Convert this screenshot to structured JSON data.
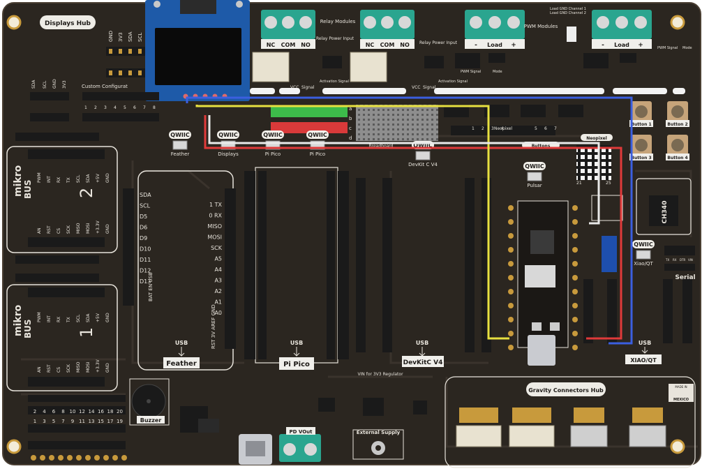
{
  "board": {
    "colors": {
      "pcb": "#2b2620",
      "trace": "#3a332c",
      "silk": "#e8e4dc",
      "header": "#1a1a1a",
      "gold": "#c89a3c",
      "terminal": "#2aa58f",
      "qwiic_bg": "#f2f0ea",
      "wire_blue": "#3b5fe0",
      "wire_red": "#e03a3a",
      "wire_yellow": "#e7e040",
      "wire_white": "#e9e9e9"
    }
  },
  "sections": {
    "displays_hub": "Displays Hub",
    "custom_config": "Custom Configurat",
    "relay_modules": "Relay Modules",
    "relay_power_input": "Relay Power Input",
    "pwm_modules": "PWM Modules",
    "gravity_hub": "Gravity Connectors Hub",
    "buzzer": "Buzzer",
    "external_supply": "External Supply",
    "pd_vout": "PD VOut",
    "vin_regulator": "VIN for 3V3 Regulator",
    "breadboard": "Breadboard",
    "buttons": "Buttons",
    "neopixel": "Neopixel",
    "serial": "Serial",
    "ch340": "CH340",
    "made_in": "MADE IN",
    "mexico": "MEXICO"
  },
  "terminals": {
    "relay1": [
      "NC",
      "COM",
      "NO"
    ],
    "relay2": [
      "NC",
      "COM",
      "NO"
    ],
    "load1": [
      "-",
      "Load",
      "+"
    ],
    "load2": [
      "-",
      "Load",
      "+"
    ]
  },
  "display_header": [
    "GND",
    "3V3",
    "SDA",
    "SCL"
  ],
  "custom_header": [
    "SDA",
    "SCL",
    "GND",
    "3V3"
  ],
  "custom_numbers": [
    "1",
    "2",
    "3",
    "4",
    "5",
    "6",
    "7",
    "8"
  ],
  "qwiic": {
    "brand": "QWIIC",
    "labels": [
      "Feather",
      "Displays",
      "Pi Pico",
      "Pi Pico",
      "DevKit C V4",
      "Pulsar",
      "Xiao/QT"
    ]
  },
  "mikrobus": {
    "brand_top": "mikro",
    "brand_bottom": "BUS",
    "slot1": "1",
    "slot2": "2",
    "top_pins": [
      "PWM",
      "INT",
      "RX",
      "TX",
      "SCL",
      "SDA",
      "+5V",
      "GND"
    ],
    "bottom_pins": [
      "AN",
      "RST",
      "CS",
      "SCK",
      "MISO",
      "MOSI",
      "+3.3V",
      "GND"
    ]
  },
  "feather_pins_left": [
    "SDA",
    "SCL",
    "D5",
    "D6",
    "D9",
    "D10",
    "D11",
    "D12",
    "D13"
  ],
  "feather_pins_right": [
    "1 TX",
    "0 RX",
    "MISO",
    "MOSI",
    "SCK",
    "A5",
    "A4",
    "A3",
    "A2",
    "A1",
    "A0"
  ],
  "feather_bottom_left": "BAT EN USB",
  "feather_bottom_right": "RST 3V AREF GND",
  "usb": "USB",
  "board_labels": [
    "Feather",
    "Pi Pico",
    "DevKitC V4",
    "XIAO/QT"
  ],
  "buttons": [
    "Button 1",
    "Button 2",
    "Button 3",
    "Button 4"
  ],
  "buzzer_numbers_top": [
    "2",
    "4",
    "6",
    "8",
    "10",
    "12",
    "14",
    "16",
    "18",
    "20"
  ],
  "buzzer_numbers_bottom": [
    "1",
    "3",
    "5",
    "7",
    "9",
    "11",
    "13",
    "15",
    "17",
    "19"
  ],
  "breadboard_rows": [
    "a",
    "b",
    "c",
    "d"
  ],
  "breadboard_numbers": [
    "1",
    "2",
    "3",
    "4",
    "5",
    "6",
    "7"
  ],
  "neopixel_index": [
    "21",
    "25"
  ],
  "relay_small": [
    "VCC",
    "Signal"
  ],
  "relay_activation": "Activation Signal",
  "serial_pins": [
    "TX",
    "RX",
    "DTR",
    "VIN"
  ],
  "pwm_small": [
    "PWM Signal",
    "Mode",
    "Load GND Channel 1",
    "Load GND Channel 2"
  ]
}
